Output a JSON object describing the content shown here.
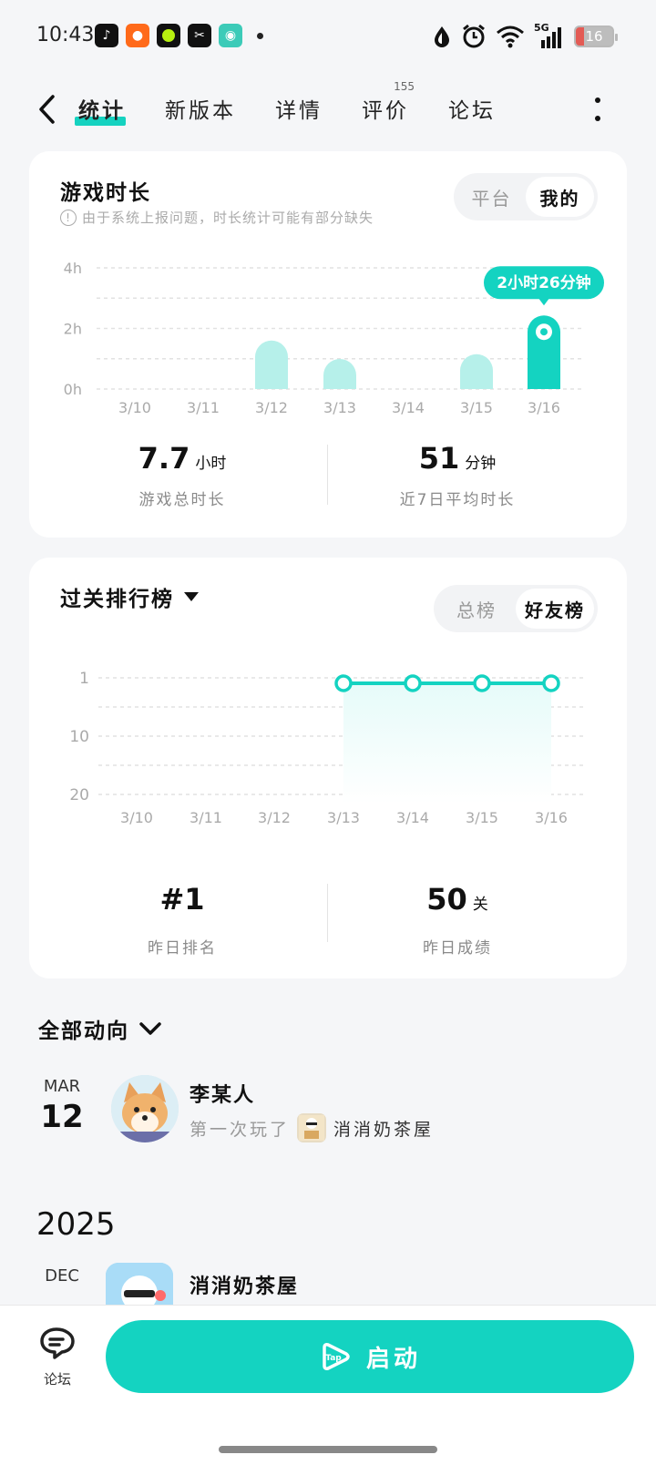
{
  "status_bar": {
    "time": "10:43",
    "network": "5G",
    "battery": "16"
  },
  "nav": {
    "tabs": [
      {
        "label": "统计",
        "active": true
      },
      {
        "label": "新版本"
      },
      {
        "label": "详情"
      },
      {
        "label": "评价",
        "badge": "155"
      },
      {
        "label": "论坛"
      }
    ]
  },
  "playtime": {
    "title": "游戏时长",
    "note": "由于系统上报问题，时长统计可能有部分缺失",
    "toggle": [
      "平台",
      "我的"
    ],
    "toggle_active": "我的",
    "tooltip": "2小时26分钟",
    "total_value": "7.7",
    "total_unit": "小时",
    "total_label": "游戏总时长",
    "avg_value": "51",
    "avg_unit": "分钟",
    "avg_label": "近7日平均时长"
  },
  "ranking": {
    "title": "过关排行榜",
    "toggle": [
      "总榜",
      "好友榜"
    ],
    "toggle_active": "好友榜",
    "rank_value": "#1",
    "rank_label": "昨日排名",
    "score_value": "50",
    "score_unit": "关",
    "score_label": "昨日成绩"
  },
  "chart_data": [
    {
      "type": "bar",
      "title": "游戏时长",
      "categories": [
        "3/10",
        "3/11",
        "3/12",
        "3/13",
        "3/14",
        "3/15",
        "3/16"
      ],
      "values": [
        0,
        0,
        1.6,
        0.9,
        0,
        1.15,
        2.43
      ],
      "yticks": [
        "0h",
        "2h",
        "4h"
      ],
      "ylim": [
        0,
        4
      ],
      "highlight_index": 6,
      "grid": true,
      "colors": {
        "highlight": "#14d3c1",
        "normal": "#b6f0ea"
      }
    },
    {
      "type": "area",
      "title": "过关排行榜",
      "categories": [
        "3/10",
        "3/11",
        "3/12",
        "3/13",
        "3/14",
        "3/15",
        "3/16"
      ],
      "values": [
        null,
        null,
        null,
        1,
        1,
        1,
        1
      ],
      "yticks": [
        "1",
        "10",
        "20"
      ],
      "y_inverted": true,
      "grid": true,
      "colors": {
        "line": "#14d3c1",
        "fill": "#e6fbf9"
      }
    }
  ],
  "feed": {
    "header": "全部动向",
    "items": [
      {
        "month": "MAR",
        "day": "12",
        "user": "李某人",
        "action": "第一次玩了",
        "game": "消消奶茶屋"
      },
      {
        "month": "DEC",
        "day": "",
        "user": "消消奶茶屋"
      }
    ],
    "year": "2025"
  },
  "bottom": {
    "forum_label": "论坛",
    "launch_label": "启动",
    "launch_logo": "Tap"
  },
  "colors": {
    "accent": "#14d3c1"
  }
}
